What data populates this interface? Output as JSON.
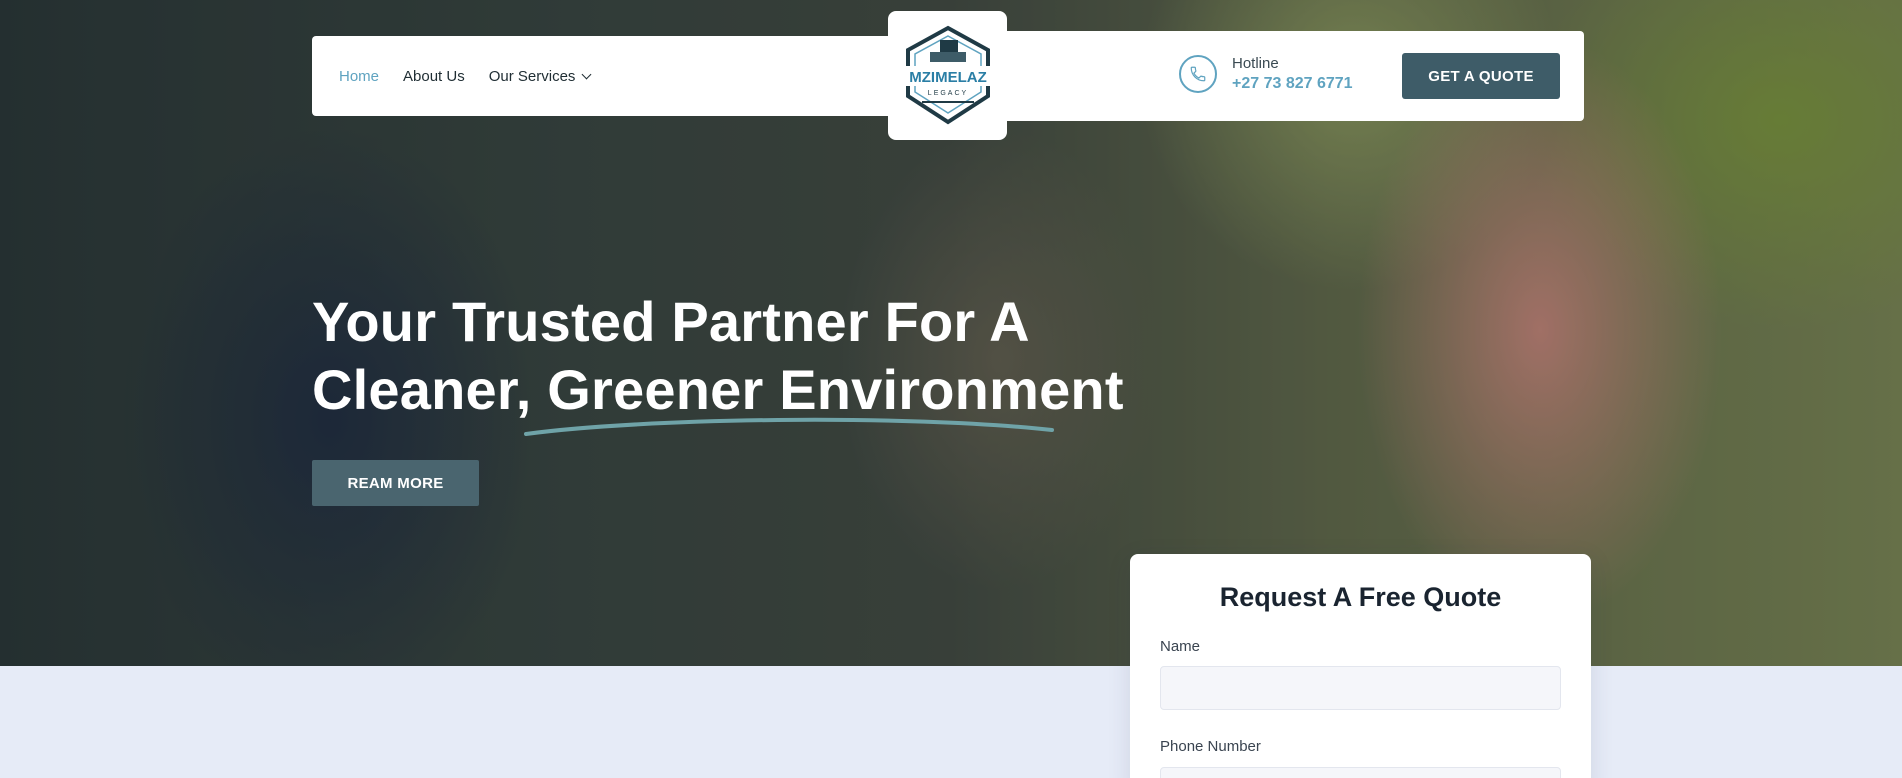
{
  "nav": {
    "items": [
      {
        "label": "Home",
        "active": true
      },
      {
        "label": "About Us",
        "active": false
      },
      {
        "label": "Our Services",
        "active": false
      }
    ]
  },
  "logo": {
    "text": "MZIMELAZ",
    "sub": "LEGACY"
  },
  "contact": {
    "label": "Hotline",
    "phone": "+27 73 827 6771"
  },
  "header": {
    "quote_button": "GET A QUOTE"
  },
  "hero": {
    "line1": "Your Trusted Partner For A",
    "line2": "Cleaner, Greener Environment",
    "button": "REAM MORE"
  },
  "quote_form": {
    "title": "Request A Free Quote",
    "name_label": "Name",
    "phone_label": "Phone Number"
  },
  "colors": {
    "accent": "#5fa3c0",
    "button": "#3e5c68",
    "page_bg": "#e6ebf7"
  }
}
